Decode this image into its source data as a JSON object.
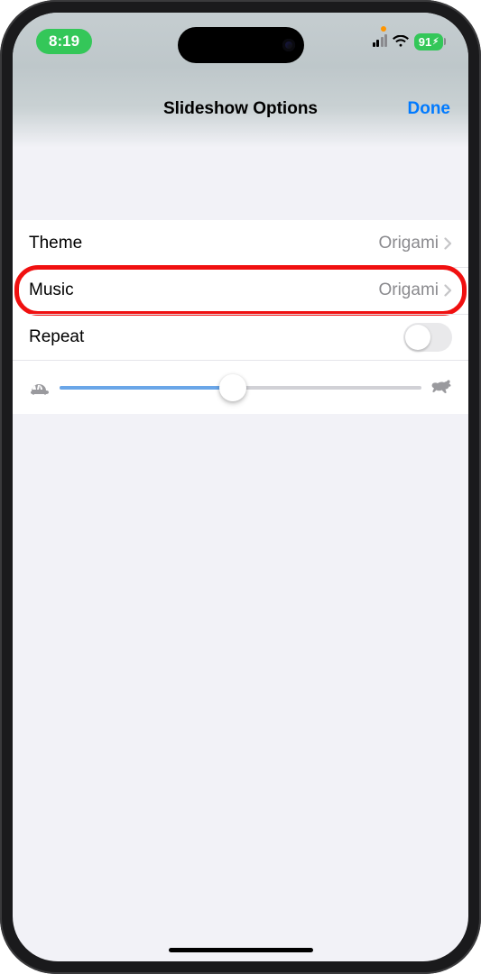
{
  "status": {
    "time": "8:19",
    "battery": "91",
    "battery_charging_glyph": "↯"
  },
  "nav": {
    "title": "Slideshow Options",
    "done": "Done"
  },
  "rows": {
    "theme": {
      "label": "Theme",
      "value": "Origami"
    },
    "music": {
      "label": "Music",
      "value": "Origami"
    },
    "repeat": {
      "label": "Repeat",
      "on": false
    }
  },
  "slider": {
    "slow_icon": "turtle",
    "fast_icon": "rabbit",
    "value_percent": 48
  },
  "highlight": "music"
}
